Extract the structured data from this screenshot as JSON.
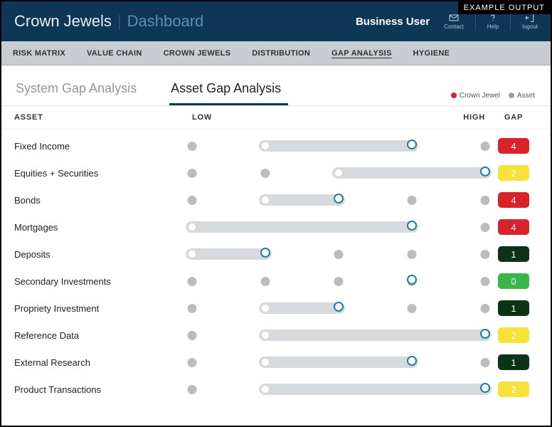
{
  "meta": {
    "example_label": "EXAMPLE OUTPUT"
  },
  "header": {
    "app_title": "Crown Jewels",
    "page_title": "Dashboard",
    "user_label": "Business User",
    "icons": [
      {
        "name": "contact",
        "label": "Contact"
      },
      {
        "name": "help",
        "label": "Help"
      },
      {
        "name": "logout",
        "label": "logout"
      }
    ]
  },
  "nav": {
    "items": [
      "RISK MATRIX",
      "VALUE CHAIN",
      "CROWN JEWELS",
      "DISTRIBUTION",
      "GAP ANALYSIS",
      "HYGIENE"
    ],
    "active_index": 4
  },
  "subtabs": {
    "items": [
      "System Gap Analysis",
      "Asset Gap Analysis"
    ],
    "active_index": 1
  },
  "legend": {
    "crown_jewel": "Crown Jewel",
    "asset": "Asset"
  },
  "columns": {
    "asset": "ASSET",
    "low": "LOW",
    "high": "HIGH",
    "gap": "GAP"
  },
  "gap_colors": {
    "4": "#d8232a",
    "2": "#f7e23a",
    "1": "#0d3316",
    "0": "#39b54a"
  },
  "scale_levels": 5,
  "rows": [
    {
      "name": "Fixed Income",
      "range": [
        1,
        3
      ],
      "gap": 4
    },
    {
      "name": "Equities + Securities",
      "range": [
        2,
        4
      ],
      "gap": 2
    },
    {
      "name": "Bonds",
      "range": [
        1,
        2
      ],
      "gap": 4
    },
    {
      "name": "Mortgages",
      "range": [
        0,
        3
      ],
      "gap": 4
    },
    {
      "name": "Deposits",
      "range": [
        0,
        1
      ],
      "gap": 1
    },
    {
      "name": "Secondary Investments",
      "range": [
        3,
        3
      ],
      "gap": 0
    },
    {
      "name": "Propriety Investment",
      "range": [
        1,
        2
      ],
      "gap": 1
    },
    {
      "name": "Reference Data",
      "range": [
        1,
        4
      ],
      "gap": 2
    },
    {
      "name": "External Research",
      "range": [
        1,
        3
      ],
      "gap": 1
    },
    {
      "name": "Product Transactions",
      "range": [
        1,
        4
      ],
      "gap": 2
    }
  ]
}
